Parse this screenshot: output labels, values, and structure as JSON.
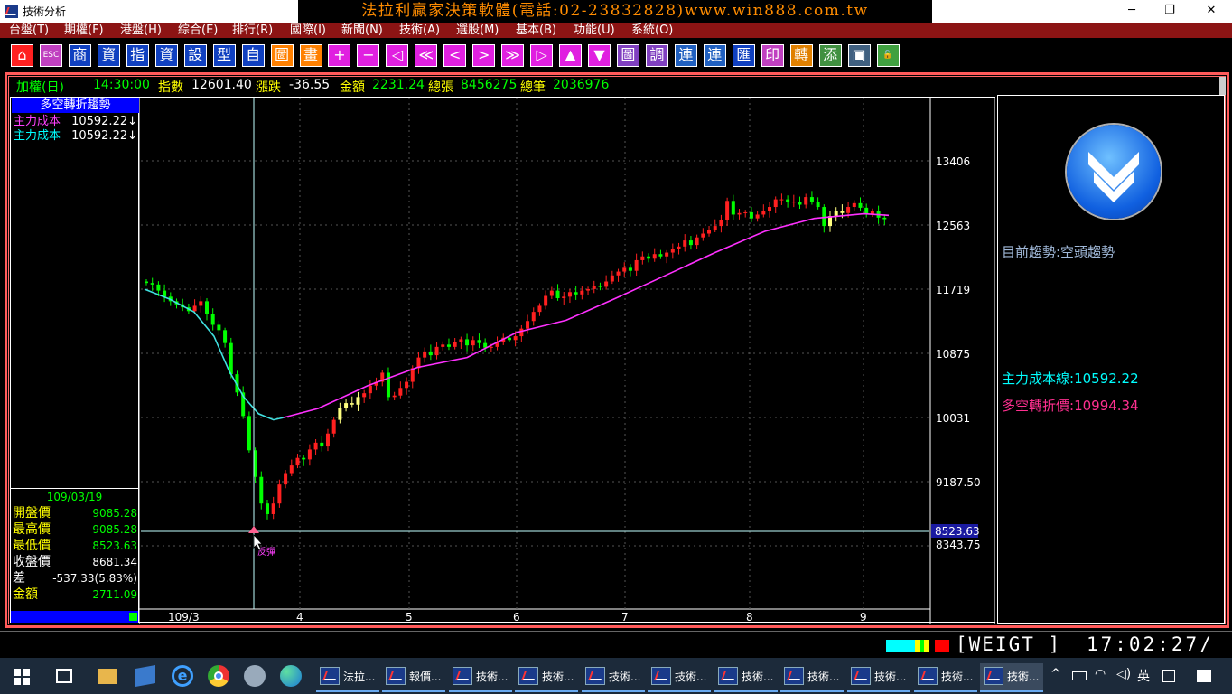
{
  "window": {
    "title": "技術分析",
    "banner": "法拉利贏家決策軟體(電話:02-23832828)www.win888.com.tw",
    "controls": [
      "─",
      "❐",
      "✕"
    ]
  },
  "menu": [
    "台盤(T)",
    "期權(F)",
    "港盤(H)",
    "綜合(E)",
    "排行(R)",
    "國際(I)",
    "新聞(N)",
    "技術(A)",
    "選股(M)",
    "基本(B)",
    "功能(U)",
    "系統(O)"
  ],
  "toolbar": [
    "⌂",
    "ESC",
    "商",
    "資",
    "指",
    "資",
    "設",
    "型",
    "自",
    "圖",
    "畫",
    "+",
    "−",
    "◁",
    "≪",
    "<",
    ">",
    "≫",
    "▷",
    "▲",
    "▼",
    "圖",
    "調",
    "連",
    "連",
    "匯",
    "印",
    "轉",
    "添",
    "▣",
    "🔓"
  ],
  "infobar": {
    "name": "加權(日)",
    "time": "14:30:00",
    "index_label": "指數",
    "index_value": "12601.40",
    "change_label": "漲跌",
    "change_value": "-36.55",
    "amount_label": "金額",
    "amount_value": "2231.24",
    "vol_label": "總張",
    "vol_value": "8456275",
    "trades_label": "總筆",
    "trades_value": "2036976"
  },
  "leftpanel": {
    "title": "多空轉折趨勢",
    "lines": [
      {
        "label": "主力成本",
        "value": "10592.22↓",
        "color": "#ff40ff"
      },
      {
        "label": "主力成本",
        "value": "10592.22↓",
        "color": "#00ffff"
      }
    ],
    "date": "109/03/19",
    "ohlc": [
      {
        "label": "開盤價",
        "value": "9085.28",
        "color": "#ffff00",
        "vcolor": "#00ff00"
      },
      {
        "label": "最高價",
        "value": "9085.28",
        "color": "#ffff00",
        "vcolor": "#00ff00"
      },
      {
        "label": "最低價",
        "value": "8523.63",
        "color": "#ffff00",
        "vcolor": "#00ff00"
      },
      {
        "label": "收盤價",
        "value": "8681.34",
        "color": "#ffffff",
        "vcolor": "#ffffff"
      },
      {
        "label": "差",
        "value": "-537.33(5.83%)",
        "color": "#ffffff",
        "vcolor": "#ffffff"
      },
      {
        "label": "金額",
        "value": "2711.09",
        "color": "#ffff00",
        "vcolor": "#00ff00"
      }
    ]
  },
  "chart_data": {
    "type": "candlestick",
    "y_ticks": [
      "13406",
      "12563",
      "11719",
      "10875",
      "10031",
      "9187.50",
      "8343.75"
    ],
    "ylim": [
      8343.75,
      13406
    ],
    "x_ticks": [
      "109/3",
      "4",
      "5",
      "6",
      "7",
      "8",
      "9"
    ],
    "crosshair": {
      "price": "8523.63",
      "label": "反彈"
    },
    "ma_cyan_points": [
      [
        0,
        11719
      ],
      [
        5,
        11590
      ],
      [
        10,
        11420
      ],
      [
        14,
        11100
      ],
      [
        17,
        10650
      ],
      [
        20,
        10300
      ],
      [
        23,
        10080
      ],
      [
        26,
        10000
      ],
      [
        28,
        10030
      ]
    ],
    "ma_magenta_points": [
      [
        28,
        10030
      ],
      [
        35,
        10150
      ],
      [
        45,
        10450
      ],
      [
        55,
        10690
      ],
      [
        65,
        10820
      ],
      [
        75,
        11150
      ],
      [
        85,
        11310
      ],
      [
        95,
        11600
      ],
      [
        105,
        11900
      ],
      [
        115,
        12200
      ],
      [
        125,
        12480
      ],
      [
        135,
        12650
      ],
      [
        145,
        12710
      ],
      [
        150,
        12690
      ]
    ],
    "candles_summary": "daily index candles from ~11800 falling to low 8523.63 then recovering to ~12600",
    "grid": true
  },
  "rightpanel": {
    "trend_label": "目前趨勢:空頭趨勢",
    "cost_label": "主力成本線:",
    "cost_value": "10592.22",
    "turn_label": "多空轉折價:",
    "turn_value": "10994.34"
  },
  "status": {
    "weigt": "[WEIGT ]",
    "clock": "17:02:27/"
  },
  "taskbar": {
    "items": [
      "法拉...",
      "報價...",
      "技術...",
      "技術...",
      "技術...",
      "技術...",
      "技術...",
      "技術...",
      "技術...",
      "技術...",
      "技術..."
    ],
    "ime": "英"
  }
}
